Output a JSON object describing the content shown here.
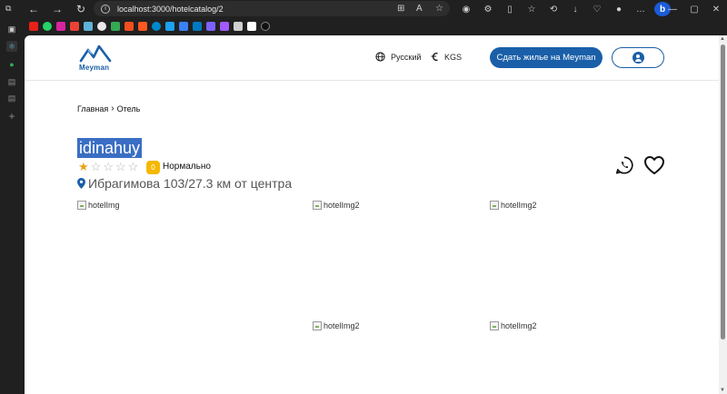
{
  "browser": {
    "url": "localhost:3000/hotelcatalog/2",
    "url_host": "localhost",
    "url_rest": ":3000/hotelcatalog/2"
  },
  "header": {
    "logo_text": "Meyman",
    "language_label": "Русский",
    "currency_label": "KGS",
    "cta_label": "Сдать жилье на Meyman"
  },
  "breadcrumb": {
    "home": "Главная",
    "current": "Отель"
  },
  "hotel": {
    "name": "idinahuy",
    "stars_filled": 1,
    "stars_total": 5,
    "rating_value": "0",
    "rating_text": "Нормально",
    "address": "Ибрагимова 103/27.3 км от центра"
  },
  "images": {
    "main_alt": "hotelImg",
    "thumb_alt": "hotelImg2"
  },
  "colors": {
    "brand": "#1a5fa8",
    "rating_badge": "#f5b800",
    "star_filled": "#e8a317",
    "selection": "#3a6ec4"
  }
}
